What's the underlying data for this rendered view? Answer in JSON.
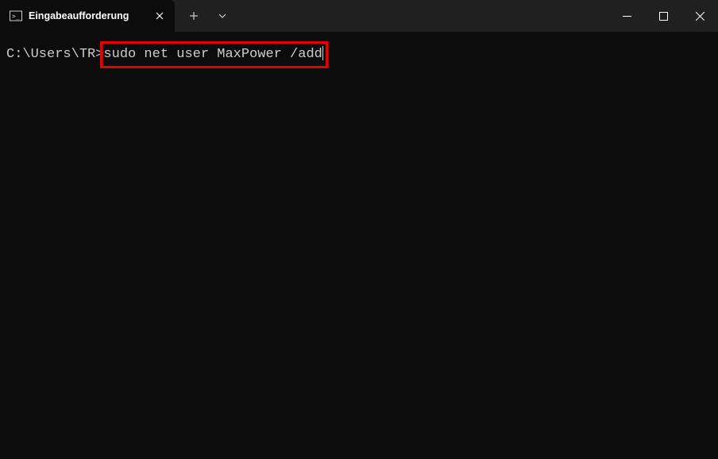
{
  "tab": {
    "title": "Eingabeaufforderung"
  },
  "terminal": {
    "prompt": "C:\\Users\\TR>",
    "command": "sudo net user MaxPower /add"
  }
}
